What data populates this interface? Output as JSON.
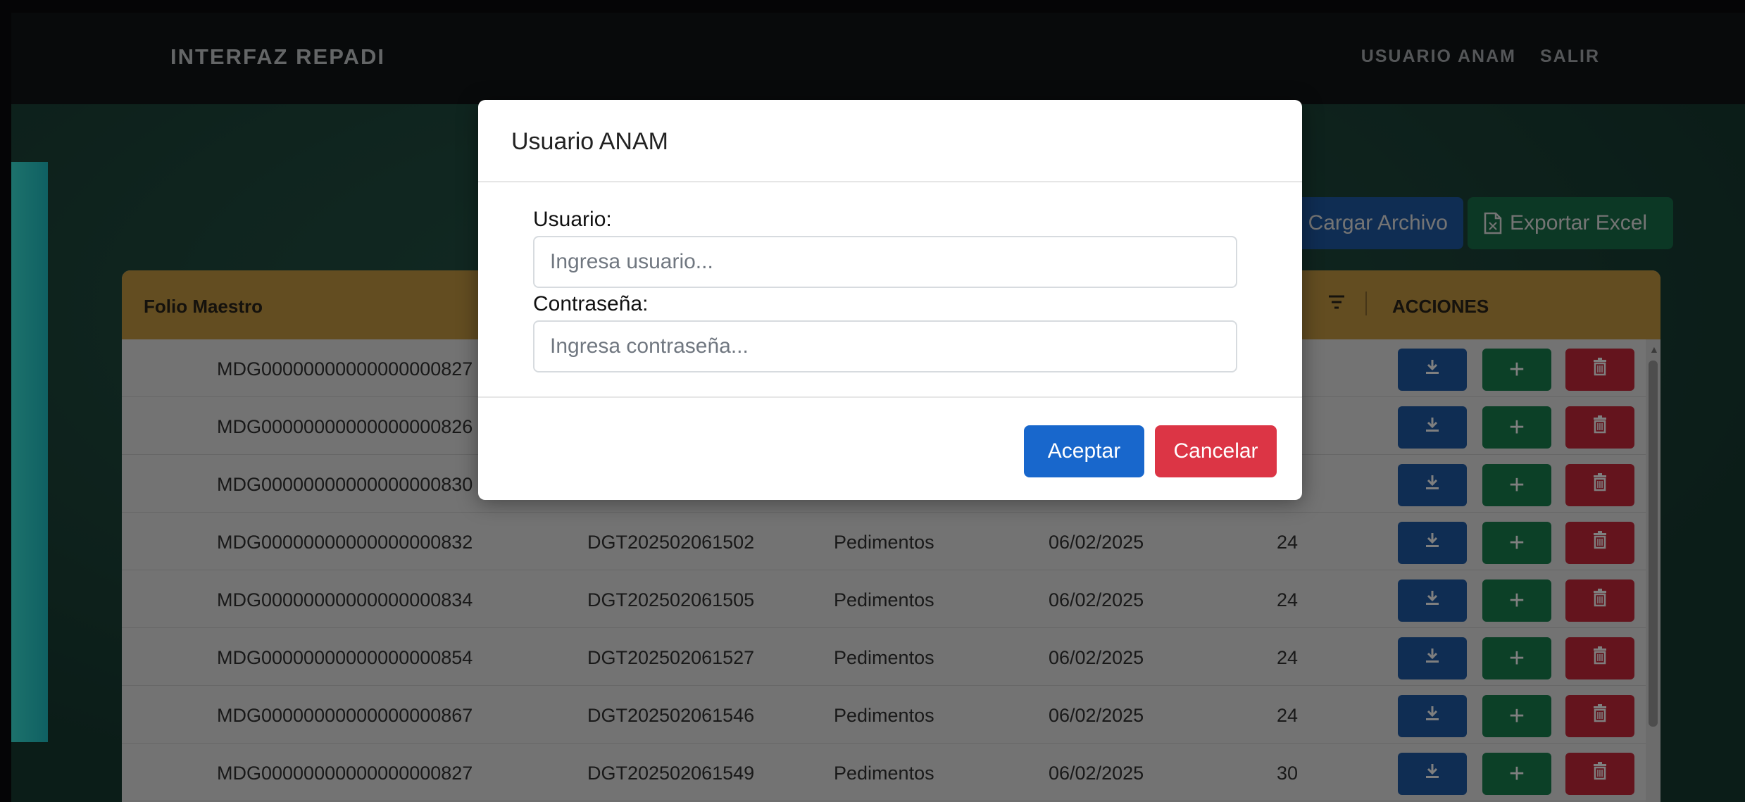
{
  "navbar": {
    "brand": "INTERFAZ REPADI",
    "user_link": "USUARIO ANAM",
    "logout_link": "SALIR"
  },
  "toolbar": {
    "load_file_label": "Cargar Archivo",
    "export_excel_label": "Exportar Excel"
  },
  "table": {
    "columns": [
      "Folio Maestro",
      "",
      "",
      "",
      "",
      "ACCIONES"
    ],
    "rows": [
      {
        "folio": "MDG00000000000000000827",
        "dgt": "",
        "tipo": "",
        "fecha": "",
        "num": ""
      },
      {
        "folio": "MDG00000000000000000826",
        "dgt": "",
        "tipo": "",
        "fecha": "",
        "num": ""
      },
      {
        "folio": "MDG00000000000000000830",
        "dgt": "",
        "tipo": "",
        "fecha": "",
        "num": ""
      },
      {
        "folio": "MDG00000000000000000832",
        "dgt": "DGT202502061502",
        "tipo": "Pedimentos",
        "fecha": "06/02/2025",
        "num": "24"
      },
      {
        "folio": "MDG00000000000000000834",
        "dgt": "DGT202502061505",
        "tipo": "Pedimentos",
        "fecha": "06/02/2025",
        "num": "24"
      },
      {
        "folio": "MDG00000000000000000854",
        "dgt": "DGT202502061527",
        "tipo": "Pedimentos",
        "fecha": "06/02/2025",
        "num": "24"
      },
      {
        "folio": "MDG00000000000000000867",
        "dgt": "DGT202502061546",
        "tipo": "Pedimentos",
        "fecha": "06/02/2025",
        "num": "24"
      },
      {
        "folio": "MDG00000000000000000827",
        "dgt": "DGT202502061549",
        "tipo": "Pedimentos",
        "fecha": "06/02/2025",
        "num": "30"
      }
    ],
    "actions": {
      "download_icon": "download-icon",
      "add_symbol": "+",
      "delete_icon": "trash-icon"
    }
  },
  "modal": {
    "title": "Usuario ANAM",
    "user_label": "Usuario:",
    "user_placeholder": "Ingresa usuario...",
    "password_label": "Contraseña:",
    "password_placeholder": "Ingresa contraseña...",
    "accept_label": "Aceptar",
    "cancel_label": "Cancelar"
  },
  "colors": {
    "navbar": "#101416",
    "table_header": "#c79a43",
    "primary": "#1e5aa6",
    "success": "#19804e",
    "danger": "#c9293a",
    "accent_bar": "#2fd3d0"
  }
}
